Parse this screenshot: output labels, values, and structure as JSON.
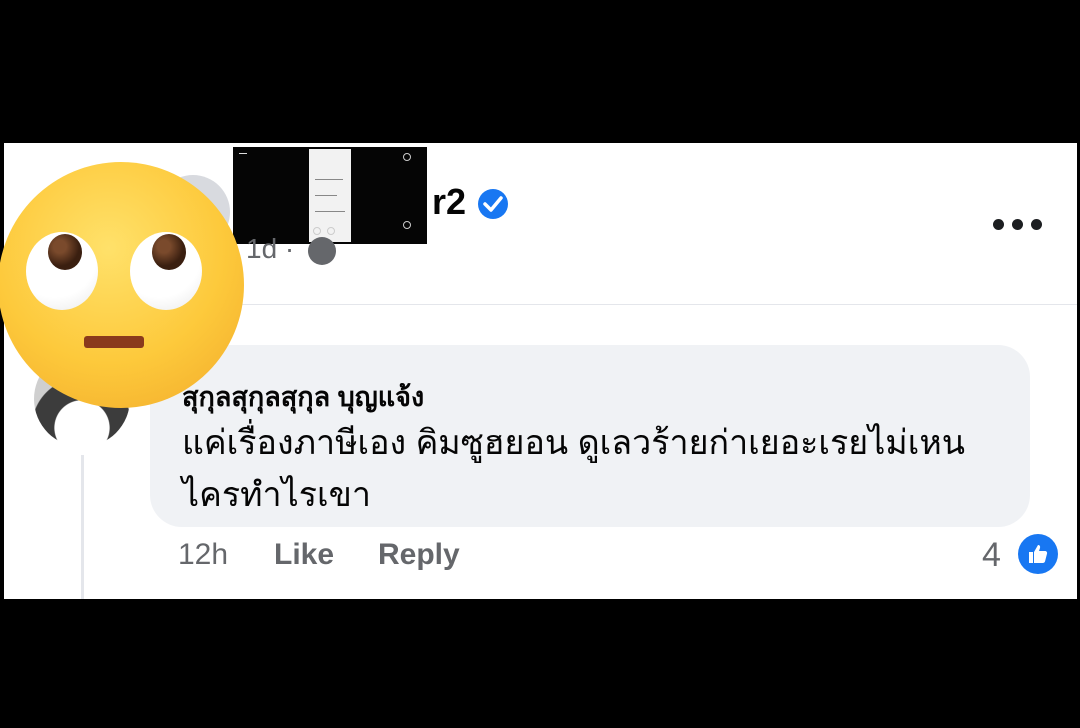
{
  "post": {
    "author_suffix": "r2",
    "time": "1d ·"
  },
  "comment": {
    "author": "สุกุลสุกุลสุกุล บุญแจ้ง",
    "text": "แค่เรื่องภาษีเอง คิมซูฮยอน ดูเลวร้ายก่าเยอะเรยไม่เหน ไครทำไรเขา",
    "time": "12h",
    "like_label": "Like",
    "reply_label": "Reply",
    "reaction_count": "4"
  },
  "icons": {
    "verified": "verified-badge-icon",
    "globe": "globe-icon",
    "more": "more-options-icon",
    "like": "like-thumb-icon",
    "emoji": "face-with-rolling-eyes-emoji"
  },
  "colors": {
    "accent": "#1877f2",
    "bubble": "#f0f2f5",
    "muted_text": "#65676b"
  }
}
